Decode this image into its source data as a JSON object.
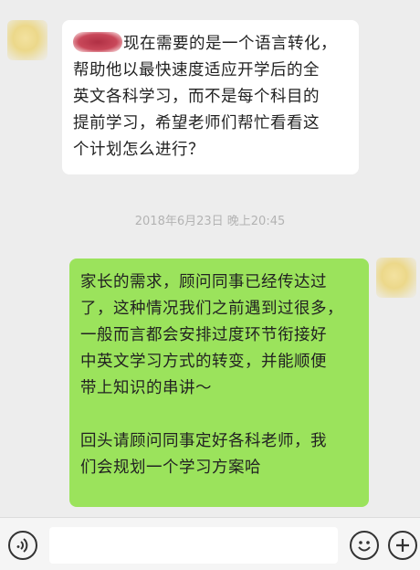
{
  "conversation": {
    "incoming": {
      "lines": [
        "现在需要的是一个语言转化，",
        "帮助他以最快速度适应开学后的全",
        "英文各科学习，而不是每个科目的",
        "提前学习，希望老师们帮忙看看这",
        "个计划怎么进行？"
      ]
    },
    "timestamp": "2018年6月23日 晚上20:45",
    "outgoing": {
      "lines": [
        "家长的需求，顾问同事已经传达过",
        "了，这种情况我们之前遇到过很多，",
        "一般而言都会安排过度环节衔接好",
        "中英文学习方式的转变，并能顺便",
        "带上知识的串讲～",
        "",
        "回头请顾问同事定好各科老师，我",
        "们会规划一个学习方案哈"
      ]
    }
  },
  "input_bar": {
    "text": "",
    "icons": [
      "voice-icon",
      "emoji-icon",
      "plus-icon"
    ]
  },
  "colors": {
    "background": "#ededed",
    "incoming_bubble": "#ffffff",
    "outgoing_bubble": "#9be35c",
    "redaction": "#b03044"
  }
}
